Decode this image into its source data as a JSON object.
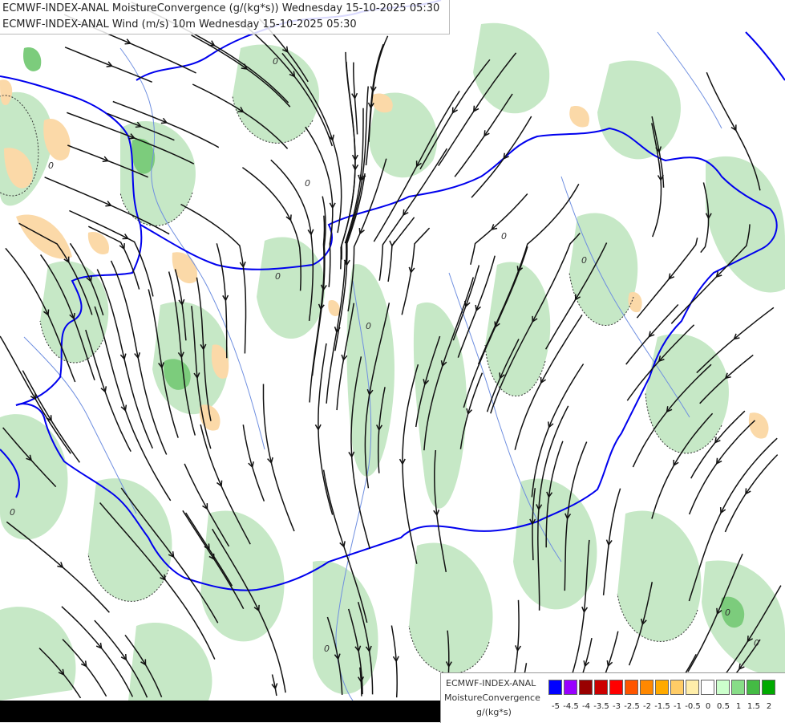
{
  "titles": {
    "line1": "ECMWF-INDEX-ANAL MoistureConvergence (g/(kg*s)) Wednesday 15-10-2025 05:30",
    "line2": "ECMWF-INDEX-ANAL Wind (m/s) 10m Wednesday 15-10-2025 05:30"
  },
  "legend": {
    "line1": "ECMWF-INDEX-ANAL",
    "line2": "MoistureConvergence",
    "units": "g/(kg*s)",
    "ticks": [
      "-5",
      "-4.5",
      "-4",
      "-3.5",
      "-3",
      "-2.5",
      "-2",
      "-1.5",
      "-1",
      "-0.5",
      "0",
      "0.5",
      "1",
      "1.5",
      "2"
    ],
    "colors": [
      "#0000ff",
      "#9900ff",
      "#990000",
      "#cc0000",
      "#ff0000",
      "#ff5500",
      "#ff8800",
      "#ffaa00",
      "#ffcc66",
      "#ffeeaa",
      "#ffffff",
      "#ccffcc",
      "#88dd88",
      "#44bb44",
      "#00aa00"
    ]
  },
  "map": {
    "colors": {
      "background": "#ffffff",
      "convergence_light": "#c6e8c6",
      "convergence_mid": "#7ccc7c",
      "divergence_light": "#fbd9a8",
      "border": "#0000ee",
      "river": "#6f8fe0",
      "streamline": "#111111"
    },
    "contour_label": "0"
  }
}
